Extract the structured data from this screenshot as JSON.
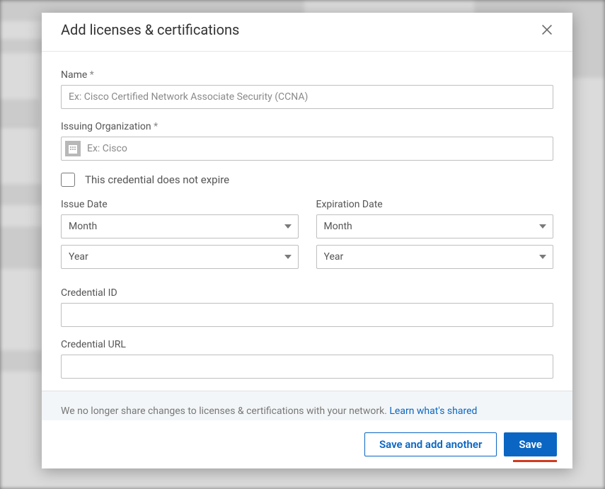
{
  "modal": {
    "title": "Add licenses & certifications",
    "name_label": "Name",
    "name_placeholder": "Ex: Cisco Certified Network Associate Security (CCNA)",
    "org_label": "Issuing Organization",
    "org_placeholder": "Ex: Cisco",
    "no_expire_label": "This credential does not expire",
    "issue_date_label": "Issue Date",
    "expiration_date_label": "Expiration Date",
    "month_placeholder": "Month",
    "year_placeholder": "Year",
    "cred_id_label": "Credential ID",
    "cred_url_label": "Credential URL",
    "notice_text": "We no longer share changes to licenses & certifications with your network. ",
    "notice_link": "Learn what's shared",
    "save_another": "Save and add another",
    "save": "Save",
    "required_mark": "*"
  }
}
